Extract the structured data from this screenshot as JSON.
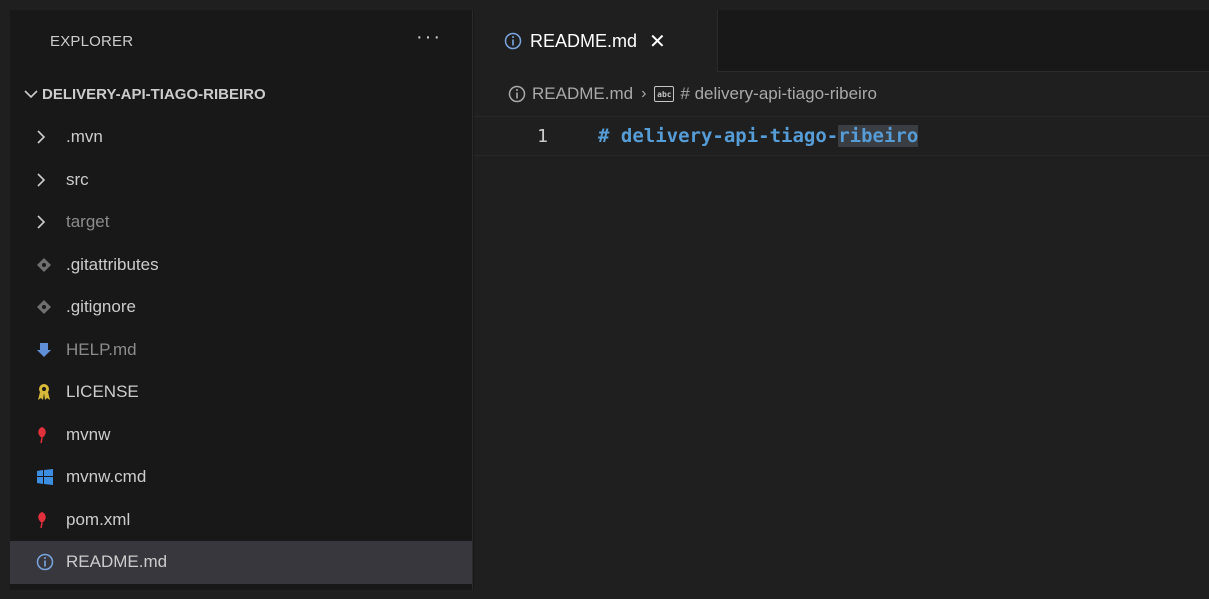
{
  "sidebar": {
    "title": "EXPLORER",
    "more_actions": "···",
    "root": {
      "label": "DELIVERY-API-TIAGO-RIBEIRO"
    },
    "items": [
      {
        "label": ".mvn",
        "icon": "chevron-right-icon"
      },
      {
        "label": "src",
        "icon": "chevron-right-icon"
      },
      {
        "label": "target",
        "icon": "chevron-right-icon"
      },
      {
        "label": ".gitattributes",
        "icon": "git-file-icon"
      },
      {
        "label": ".gitignore",
        "icon": "git-file-icon"
      },
      {
        "label": "HELP.md",
        "icon": "markdown-down-arrow-icon"
      },
      {
        "label": "LICENSE",
        "icon": "license-ribbon-icon"
      },
      {
        "label": "mvnw",
        "icon": "maven-feather-icon"
      },
      {
        "label": "mvnw.cmd",
        "icon": "windows-icon"
      },
      {
        "label": "pom.xml",
        "icon": "maven-feather-icon"
      },
      {
        "label": "README.md",
        "icon": "info-icon"
      }
    ]
  },
  "editor": {
    "tab": {
      "label": "README.md",
      "close": "✕"
    },
    "breadcrumb": {
      "file": "README.md",
      "separator": "›",
      "symbol": "# delivery-api-tiago-ribeiro",
      "symbol_icon_text": "abc"
    },
    "lines": [
      {
        "number": "1",
        "text_plain": "# delivery-api-tiago-",
        "text_highlight": "ribeiro"
      }
    ]
  },
  "colors": {
    "heading": "#569cd6",
    "selection_bg": "#37373d",
    "background": "#181818"
  }
}
